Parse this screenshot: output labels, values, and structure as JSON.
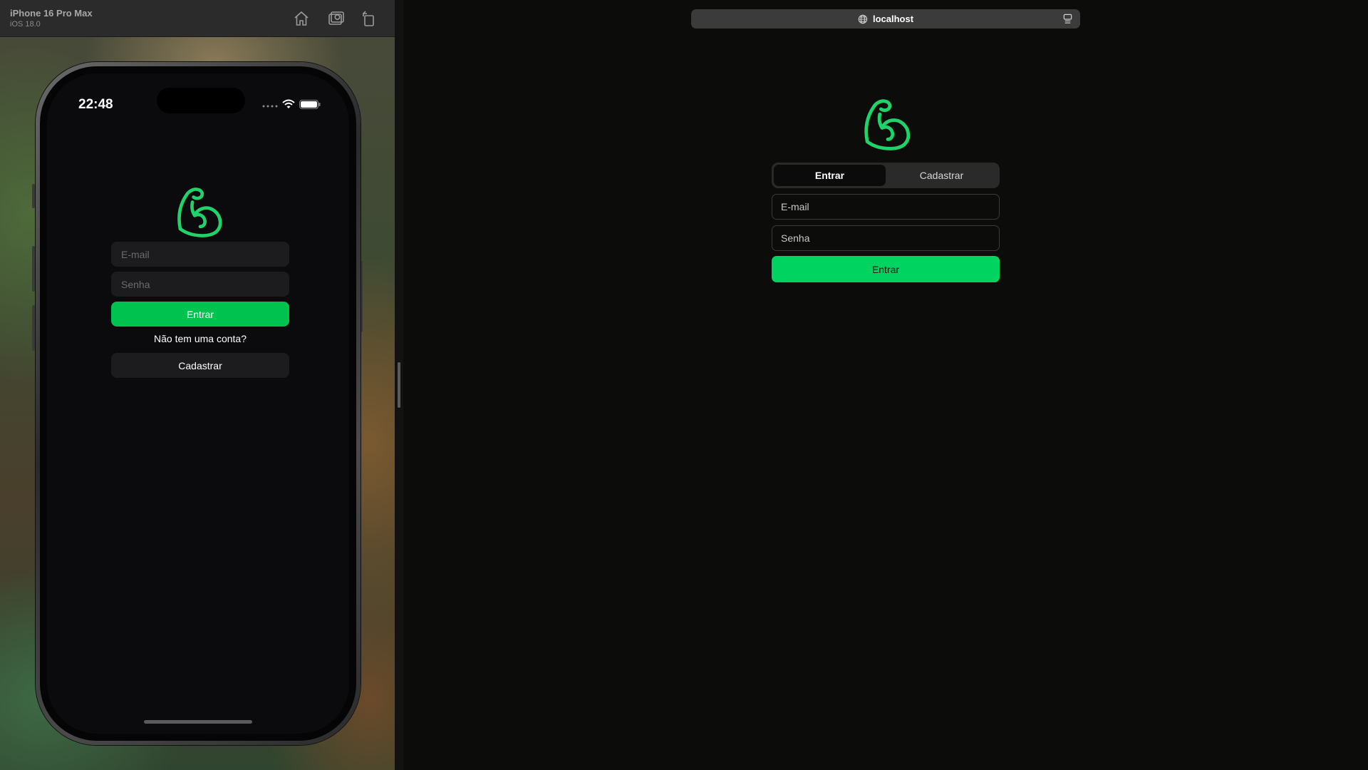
{
  "simulator": {
    "device_name": "iPhone 16 Pro Max",
    "os_version": "iOS 18.0",
    "tools": [
      "home-icon",
      "screenshot-icon",
      "rotate-icon"
    ]
  },
  "phone": {
    "status_time": "22:48",
    "status_icons": [
      "cellular-icon",
      "wifi-icon",
      "battery-icon"
    ],
    "logo_icon": "flexed-biceps-icon",
    "email_placeholder": "E-mail",
    "password_placeholder": "Senha",
    "login_button": "Entrar",
    "signup_prompt": "Não tem uma conta?",
    "signup_button": "Cadastrar"
  },
  "browser": {
    "url": "localhost",
    "logo_icon": "flexed-biceps-icon",
    "tabs": [
      {
        "label": "Entrar",
        "active": true
      },
      {
        "label": "Cadastrar",
        "active": false
      }
    ],
    "email_placeholder": "E-mail",
    "password_placeholder": "Senha",
    "submit_button": "Entrar"
  },
  "colors": {
    "accent_mobile": "#00c24e",
    "accent_web": "#00d35f",
    "logo_green": "#1fd36a"
  }
}
